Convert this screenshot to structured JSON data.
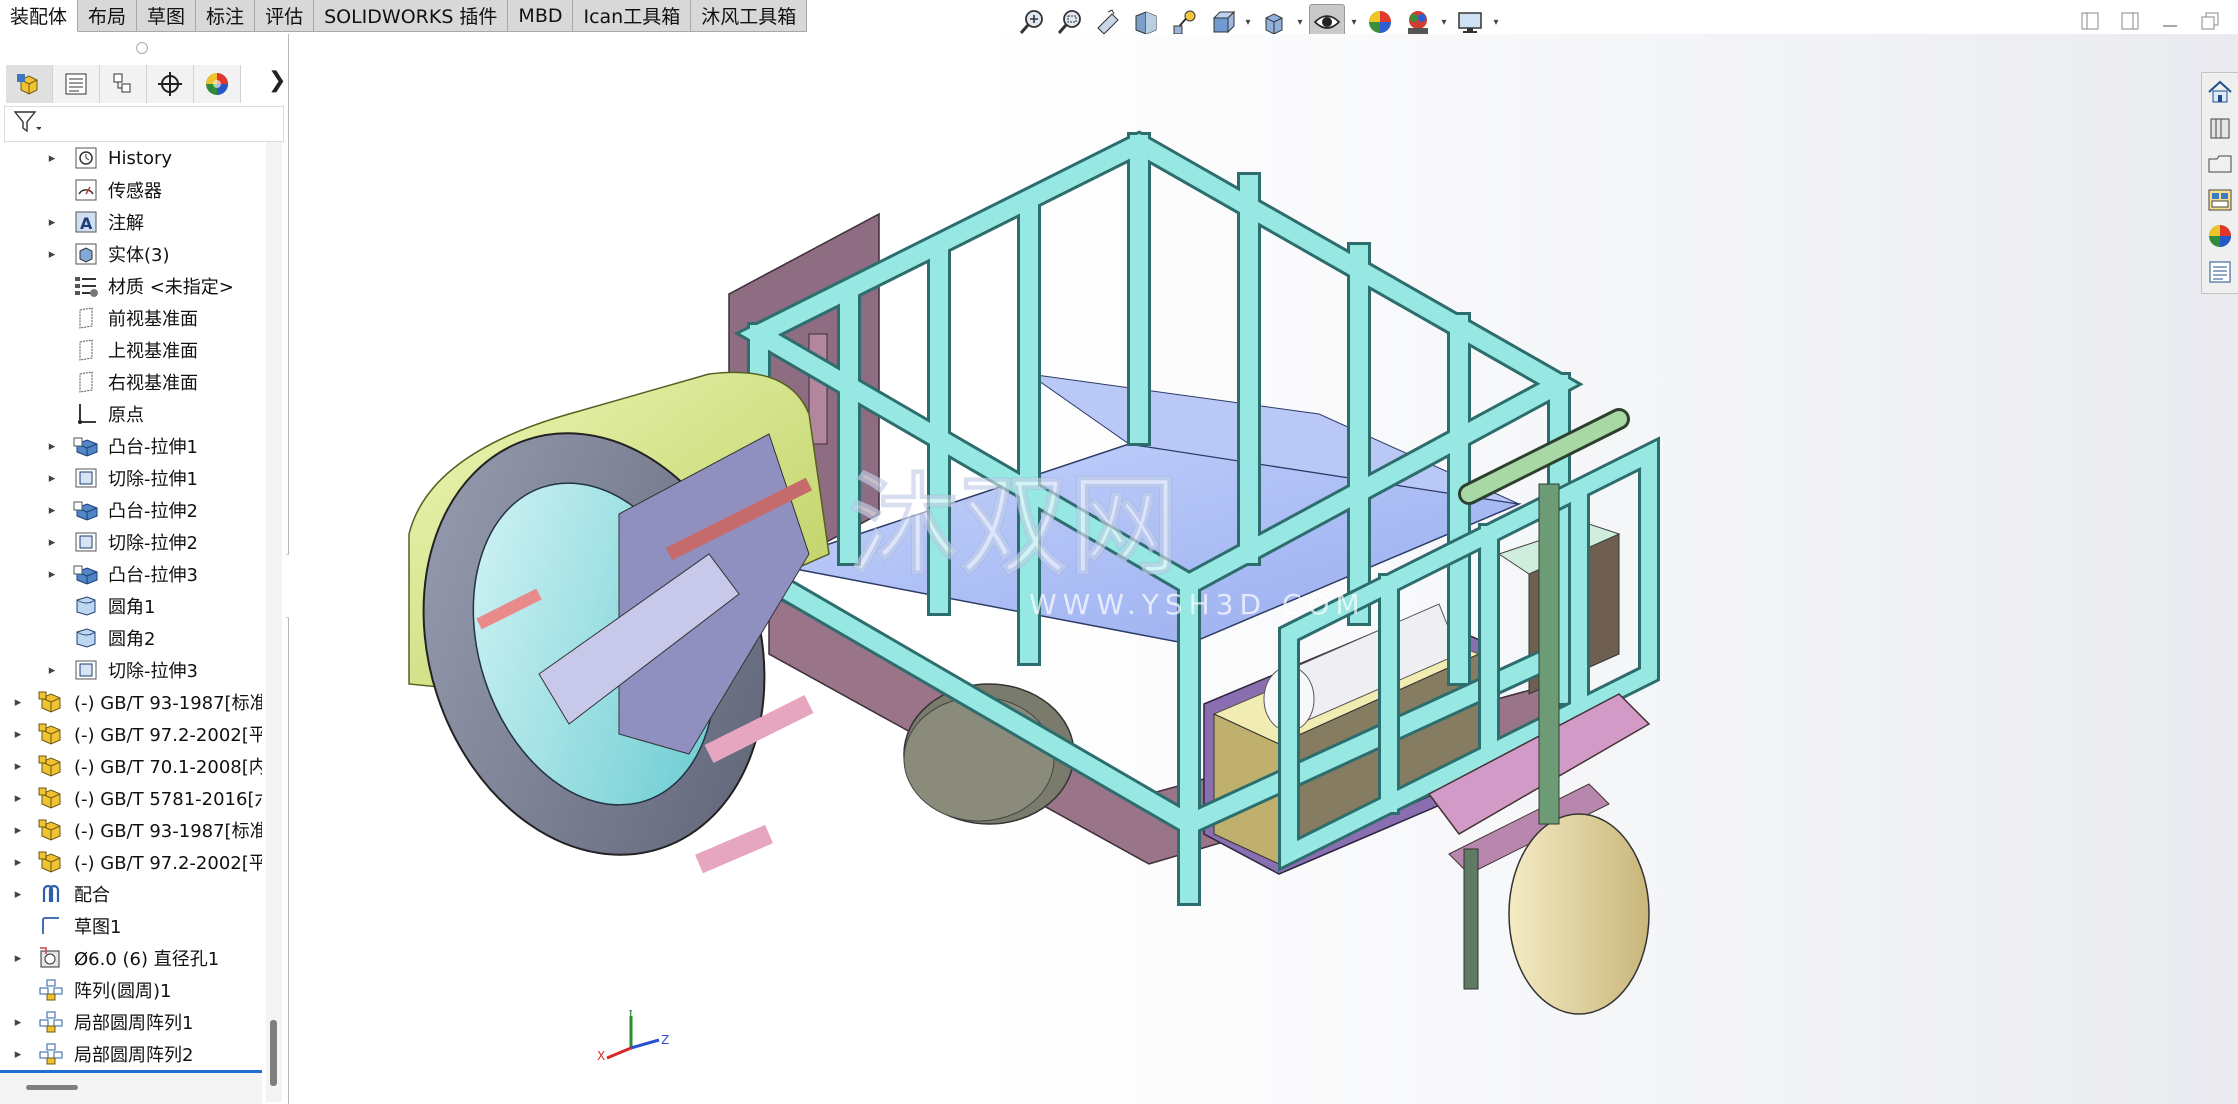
{
  "tabs": [
    {
      "label": "装配体",
      "active": true
    },
    {
      "label": "布局"
    },
    {
      "label": "草图"
    },
    {
      "label": "标注"
    },
    {
      "label": "评估"
    },
    {
      "label": "SOLIDWORKS 插件"
    },
    {
      "label": "MBD"
    },
    {
      "label": "Ican工具箱"
    },
    {
      "label": "沐风工具箱"
    }
  ],
  "hud_icons": [
    "zoom-to-fit-icon",
    "zoom-to-area-icon",
    "previous-view-icon",
    "section-view-icon",
    "dynamic-annotation-icon",
    "view-orientation-icon",
    "display-style-icon",
    "hide-show-items-icon",
    "edit-appearance-icon",
    "apply-scene-icon",
    "view-settings-icon"
  ],
  "window_controls": [
    "restore-pane-left-icon",
    "restore-pane-right-icon",
    "minimize-icon",
    "restore-icon"
  ],
  "panel_tabs": [
    "featuremanager-icon",
    "propertymanager-icon",
    "configurationmanager-icon",
    "dimxpert-icon",
    "displaymanager-icon"
  ],
  "tree": {
    "items": [
      {
        "label": "History",
        "level": 1,
        "expandable": true,
        "icon": "history-icon"
      },
      {
        "label": "传感器",
        "level": 1,
        "expandable": false,
        "icon": "sensor-icon"
      },
      {
        "label": "注解",
        "level": 1,
        "expandable": true,
        "icon": "annotation-icon"
      },
      {
        "label": "实体(3)",
        "level": 1,
        "expandable": true,
        "icon": "solid-bodies-icon"
      },
      {
        "label": "材质 <未指定>",
        "level": 1,
        "expandable": false,
        "icon": "material-icon"
      },
      {
        "label": "前视基准面",
        "level": 1,
        "expandable": false,
        "icon": "plane-icon"
      },
      {
        "label": "上视基准面",
        "level": 1,
        "expandable": false,
        "icon": "plane-icon"
      },
      {
        "label": "右视基准面",
        "level": 1,
        "expandable": false,
        "icon": "plane-icon"
      },
      {
        "label": "原点",
        "level": 1,
        "expandable": false,
        "icon": "origin-icon"
      },
      {
        "label": "凸台-拉伸1",
        "level": 1,
        "expandable": true,
        "icon": "boss-extrude-icon"
      },
      {
        "label": "切除-拉伸1",
        "level": 1,
        "expandable": true,
        "icon": "cut-extrude-icon"
      },
      {
        "label": "凸台-拉伸2",
        "level": 1,
        "expandable": true,
        "icon": "boss-extrude-icon"
      },
      {
        "label": "切除-拉伸2",
        "level": 1,
        "expandable": true,
        "icon": "cut-extrude-icon"
      },
      {
        "label": "凸台-拉伸3",
        "level": 1,
        "expandable": true,
        "icon": "boss-extrude-icon"
      },
      {
        "label": "圆角1",
        "level": 1,
        "expandable": false,
        "icon": "fillet-icon"
      },
      {
        "label": "圆角2",
        "level": 1,
        "expandable": false,
        "icon": "fillet-icon"
      },
      {
        "label": "切除-拉伸3",
        "level": 1,
        "expandable": true,
        "icon": "cut-extrude-icon"
      },
      {
        "label": "(-) GB/T 93-1987[标准",
        "level": 0,
        "expandable": true,
        "icon": "part-icon"
      },
      {
        "label": "(-) GB/T 97.2-2002[平",
        "level": 0,
        "expandable": true,
        "icon": "part-icon"
      },
      {
        "label": "(-) GB/T 70.1-2008[内",
        "level": 0,
        "expandable": true,
        "icon": "part-icon"
      },
      {
        "label": "(-) GB/T 5781-2016[六",
        "level": 0,
        "expandable": true,
        "icon": "part-icon"
      },
      {
        "label": "(-) GB/T 93-1987[标准",
        "level": 0,
        "expandable": true,
        "icon": "part-icon"
      },
      {
        "label": "(-) GB/T 97.2-2002[平",
        "level": 0,
        "expandable": true,
        "icon": "part-icon"
      },
      {
        "label": "配合",
        "level": 0,
        "expandable": true,
        "icon": "mates-icon"
      },
      {
        "label": "草图1",
        "level": 0,
        "expandable": false,
        "icon": "sketch-icon"
      },
      {
        "label": "Ø6.0 (6) 直径孔1",
        "level": 0,
        "expandable": true,
        "icon": "hole-wizard-icon"
      },
      {
        "label": "阵列(圆周)1",
        "level": 0,
        "expandable": false,
        "icon": "circular-pattern-icon"
      },
      {
        "label": "局部圆周阵列1",
        "level": 0,
        "expandable": true,
        "icon": "circular-pattern-icon"
      },
      {
        "label": "局部圆周阵列2",
        "level": 0,
        "expandable": true,
        "icon": "circular-pattern-icon"
      }
    ]
  },
  "watermark": {
    "main": "沐双网",
    "sub": "WWW.YSH3D.COM"
  },
  "triad": {
    "x": "X",
    "y": "Y",
    "z": "Z"
  },
  "task_pane": [
    "home-icon",
    "design-library-icon",
    "file-explorer-icon",
    "view-palette-icon",
    "appearances-icon",
    "custom-properties-icon"
  ],
  "colors": {
    "frame": "#8fe3e0",
    "frame_dark": "#4a9c9c",
    "floor": "#a8bdf5",
    "drum_cover": "#d9ec8a",
    "drum": "#7b7f92",
    "drum_inner": "#9fe6e8",
    "chassis": "#b28aa0",
    "wheel": "#7e7e6e",
    "rear_wheel": "#e6d7a5",
    "battery": "#f3eeb0",
    "mount": "#b48ad6"
  }
}
